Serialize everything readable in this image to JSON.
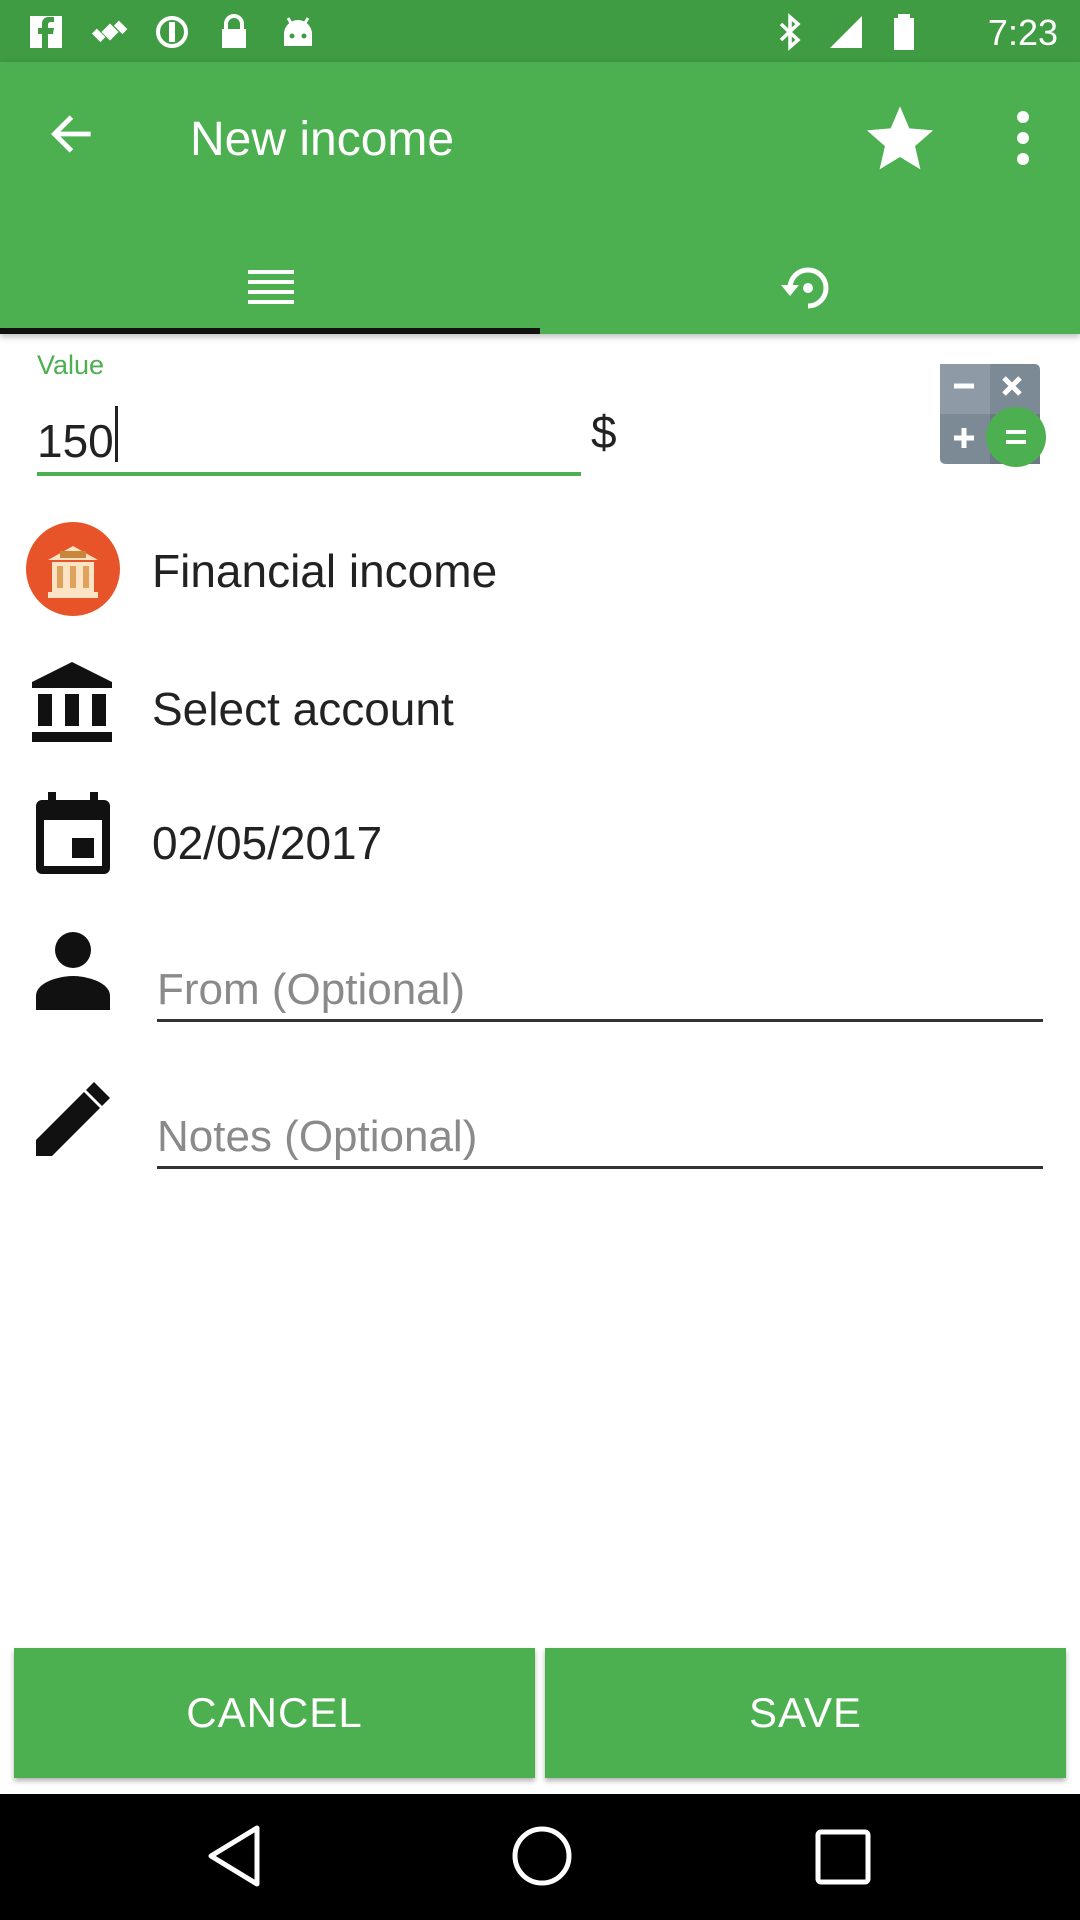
{
  "status_bar": {
    "time": "7:23",
    "icons": [
      "facebook-icon",
      "satellite-icon",
      "sync-icon",
      "lock-icon",
      "android-icon",
      "bluetooth-icon",
      "signal-icon",
      "battery-icon"
    ]
  },
  "app_bar": {
    "title": "New income",
    "back_icon": "arrow-back-icon",
    "favorite_icon": "star-icon",
    "menu_icon": "more-vert-icon"
  },
  "tabs": [
    {
      "icon": "list-icon",
      "active": true
    },
    {
      "icon": "history-icon",
      "active": false
    }
  ],
  "value": {
    "label": "Value",
    "amount": "150",
    "currency": "$",
    "calculator_icon": "calculator-icon"
  },
  "rows": {
    "category": "Financial income",
    "account": "Select account",
    "date": "02/05/2017"
  },
  "inputs": {
    "from_placeholder": "From (Optional)",
    "notes_placeholder": "Notes (Optional)"
  },
  "buttons": {
    "cancel": "CANCEL",
    "save": "SAVE"
  },
  "colors": {
    "primary": "#4caf50",
    "primary_dark": "#3f9c42",
    "category_icon_bg": "#e8542a"
  }
}
